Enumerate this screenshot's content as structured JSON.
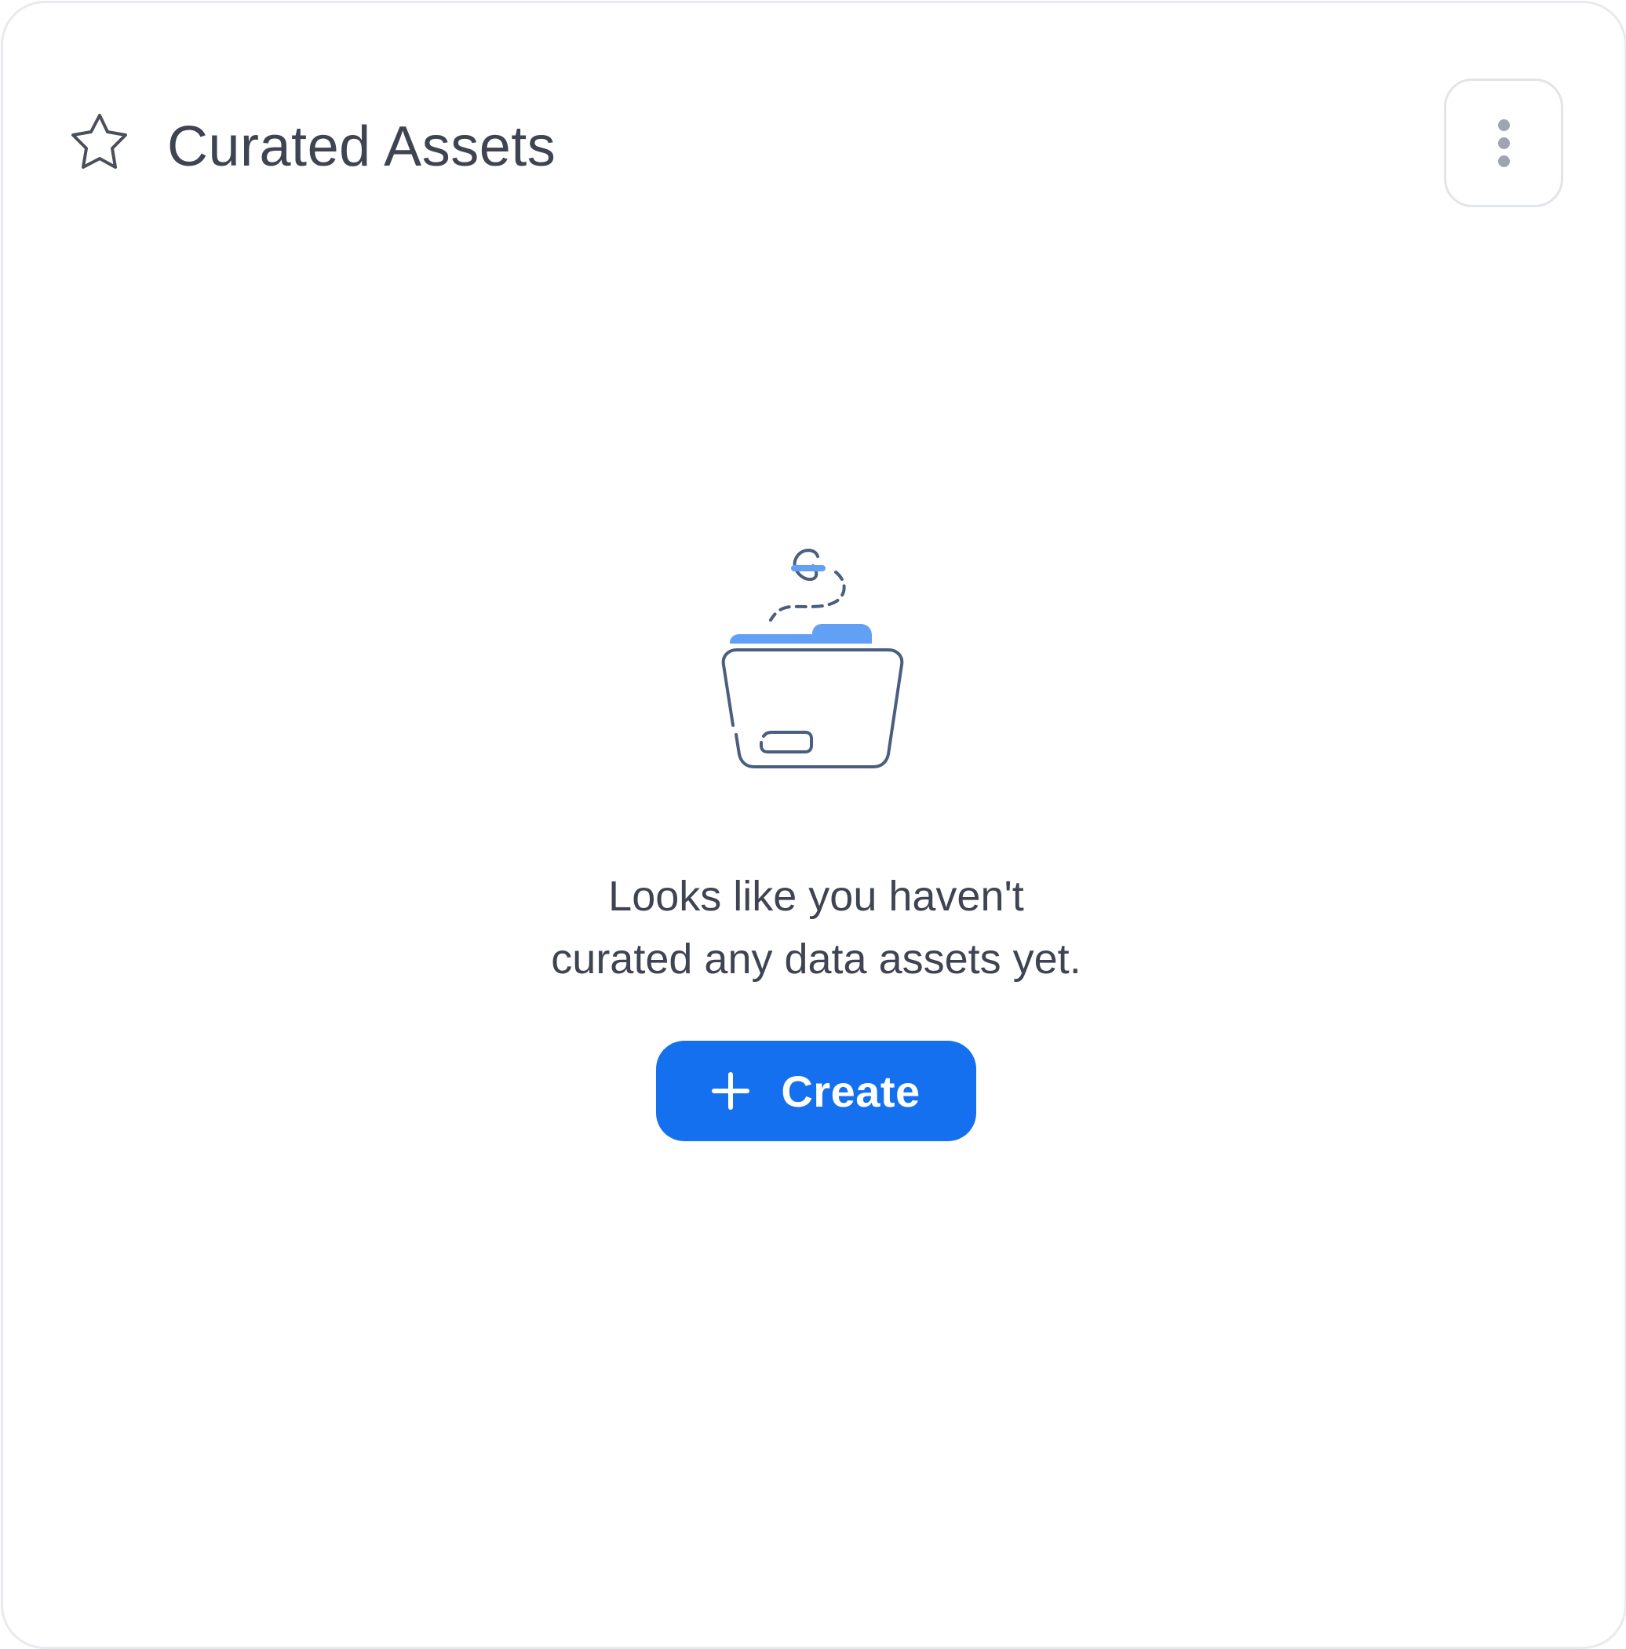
{
  "widget": {
    "title": "Curated Assets",
    "title_icon": "star-icon",
    "menu_icon": "more-vertical-icon"
  },
  "empty_state": {
    "illustration": "open-folder-illustration",
    "message_line1": "Looks like you haven't",
    "message_line2": "curated any data assets yet.",
    "button_label": "Create",
    "button_icon": "plus-icon"
  },
  "colors": {
    "accent": "#1570ef",
    "illustration_fill": "#62a0f5",
    "illustration_stroke": "#4a5e80",
    "text": "#3f4453",
    "border": "#e8eaf0"
  }
}
